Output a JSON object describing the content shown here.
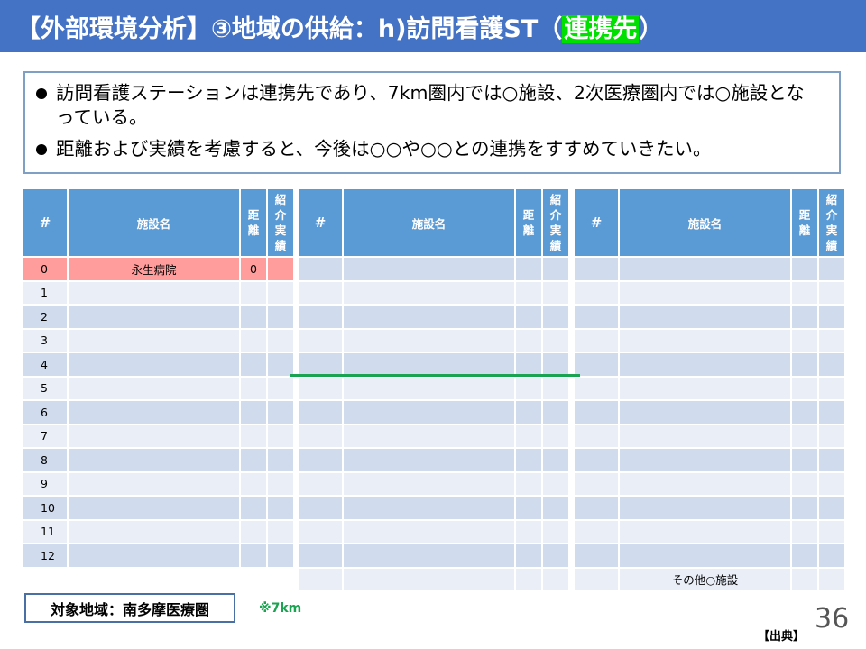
{
  "title": {
    "main": "【外部環境分析】③地域の供給：h)訪問看護ST（",
    "highlight": "連携先",
    "close": "）"
  },
  "bullets": [
    "訪問看護ステーションは連携先であり、7km圏内では○施設、2次医療圏内では○施設となっている。",
    "距離および実績を考慮すると、今後は○○や○○との連携をすすめていきたい。"
  ],
  "table_headers": {
    "hash": "#",
    "facility": "施設名",
    "distance": "距離",
    "referral": "紹介実績"
  },
  "table1_rows": [
    {
      "n": "0",
      "name": "永生病院",
      "dist": "0",
      "ref": "-"
    },
    {
      "n": "1",
      "name": "",
      "dist": "",
      "ref": ""
    },
    {
      "n": "2",
      "name": "",
      "dist": "",
      "ref": ""
    },
    {
      "n": "3",
      "name": "",
      "dist": "",
      "ref": ""
    },
    {
      "n": "4",
      "name": "",
      "dist": "",
      "ref": ""
    },
    {
      "n": "5",
      "name": "",
      "dist": "",
      "ref": ""
    },
    {
      "n": "6",
      "name": "",
      "dist": "",
      "ref": ""
    },
    {
      "n": "7",
      "name": "",
      "dist": "",
      "ref": ""
    },
    {
      "n": "8",
      "name": "",
      "dist": "",
      "ref": ""
    },
    {
      "n": "9",
      "name": "",
      "dist": "",
      "ref": ""
    },
    {
      "n": "10",
      "name": "",
      "dist": "",
      "ref": ""
    },
    {
      "n": "11",
      "name": "",
      "dist": "",
      "ref": ""
    },
    {
      "n": "12",
      "name": "",
      "dist": "",
      "ref": ""
    }
  ],
  "table3_last_name": "その他○施設",
  "region_label": "対象地域：南多摩医療圏",
  "distance_note": "※7km",
  "page_number": "36",
  "source_label": "【出典】",
  "colors": {
    "title_bar": "#4472c4",
    "header": "#5b9bd5",
    "row_dark": "#d0dcee",
    "row_light": "#e9eef7",
    "highlight_row": "#ff9c9c",
    "accent_green": "#1aa350",
    "title_highlight": "#00e000"
  }
}
